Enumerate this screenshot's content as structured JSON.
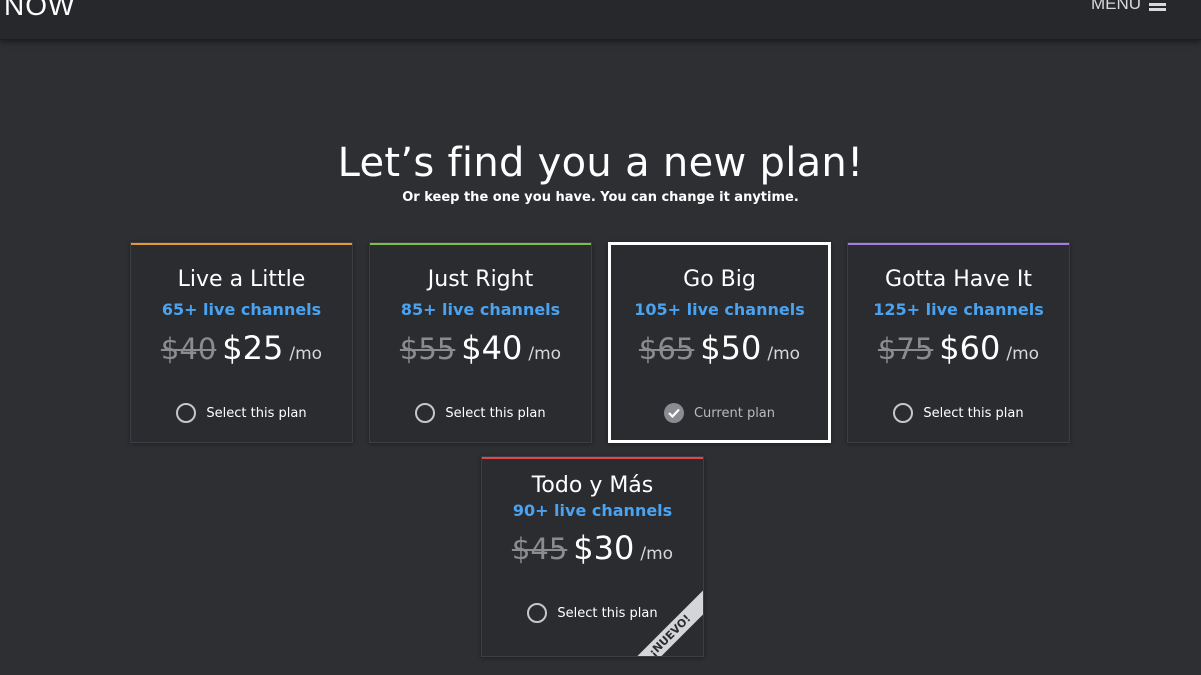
{
  "header": {
    "logo_text": "NOW",
    "menu_label": "MENU"
  },
  "title": "Let’s find you a new plan!",
  "subtitle": "Or keep the one you have. You can change it anytime.",
  "colors": {
    "background": "#2d2f33",
    "channels_text": "#4aa3f0",
    "live_a_little": "#e8962e",
    "just_right": "#7bbf43",
    "gotta_have_it": "#a57be3",
    "todo_y_mas": "#e0474c"
  },
  "plans": [
    {
      "name": "Live a Little",
      "channels": "65+ live channels",
      "old_price": "$40",
      "price": "$25",
      "per": "/mo",
      "action": "Select this plan"
    },
    {
      "name": "Just Right",
      "channels": "85+ live channels",
      "old_price": "$55",
      "price": "$40",
      "per": "/mo",
      "action": "Select this plan"
    },
    {
      "name": "Go Big",
      "channels": "105+ live channels",
      "old_price": "$65",
      "price": "$50",
      "per": "/mo",
      "action": "Current plan"
    },
    {
      "name": "Gotta Have It",
      "channels": "125+ live channels",
      "old_price": "$75",
      "price": "$60",
      "per": "/mo",
      "action": "Select this plan"
    },
    {
      "name": "Todo y Más",
      "channels": "90+ live channels",
      "old_price": "$45",
      "price": "$30",
      "per": "/mo",
      "action": "Select this plan",
      "badge": "¡NUEVO!"
    }
  ]
}
